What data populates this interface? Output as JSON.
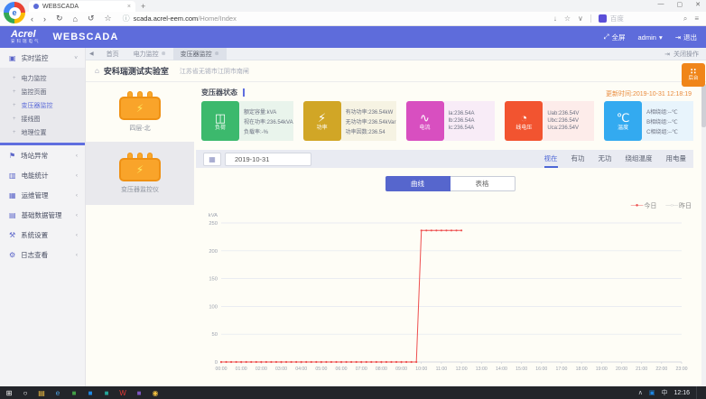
{
  "browser": {
    "tab_title": "WEBSCADA",
    "logo_glyph": "e",
    "url_host": "scada.acrel-eem.com",
    "url_path": "/Home/Index",
    "search_engine": "百度",
    "icons": {
      "back": "‹",
      "forward": "›",
      "refresh": "↻",
      "home": "⌂",
      "history": "↺",
      "star": "☆",
      "site_info": "ⓘ",
      "download": "↓",
      "fav": "☆",
      "caret": "∨",
      "search": "⌕",
      "menu": "≡",
      "minimize": "—",
      "maximize": "▢",
      "close": "✕",
      "tab_close": "×",
      "new_tab": "+"
    }
  },
  "app_header": {
    "brand_en": "Acrel",
    "brand_cn": "安科瑞电气",
    "product": "WEBSCADA",
    "fullscreen_icon": "⤢",
    "fullscreen_label": "全屏",
    "user": "admin",
    "user_caret": "▾",
    "logout_icon": "⇥",
    "logout_label": "退出"
  },
  "tab_bar": {
    "collapse_icon": "◀",
    "tabs": [
      {
        "label": "首页"
      },
      {
        "label": "电力监控",
        "close_icon": "⊗"
      },
      {
        "label": "变压器监控",
        "close_icon": "⊗"
      }
    ],
    "close_ops_icon": "⇥",
    "close_ops_label": "关闭操作"
  },
  "sidebar": {
    "groups": [
      {
        "icon": "▣",
        "label": "实时监控",
        "chevron": "˅",
        "children": [
          "电力监控",
          "监控页面",
          "变压器监控",
          "接线图",
          "地理位置"
        ],
        "child_bullet": "+"
      },
      {
        "icon": "⚑",
        "label": "场站异常",
        "chevron": "‹"
      },
      {
        "icon": "▥",
        "label": "电能统计",
        "chevron": "‹"
      },
      {
        "icon": "▦",
        "label": "运维管理",
        "chevron": "‹"
      },
      {
        "icon": "▤",
        "label": "基础数据管理",
        "chevron": "‹"
      },
      {
        "icon": "⚒",
        "label": "系统设置",
        "chevron": "‹"
      },
      {
        "icon": "⚙",
        "label": "日志查看",
        "chevron": "‹"
      }
    ]
  },
  "station": {
    "home_icon": "⌂",
    "name": "安科瑞测试实验室",
    "address": "江苏省无锡市江阴市南闸"
  },
  "devices": [
    {
      "label": "四层-北",
      "bolt": "⚡"
    },
    {
      "label": "变压器监控仪",
      "bolt": "⚡"
    }
  ],
  "status": {
    "title": "变压器状态",
    "updated": "更新时间:2019-10-31 12:18:19",
    "cards": [
      {
        "label": "负荷",
        "glyph": "◫",
        "color": "#3cb96d",
        "bg": "#e9f4ec",
        "lines": [
          "额定容量:kVA",
          "视在功率:236.54kVA",
          "负载率:-%"
        ]
      },
      {
        "label": "功率",
        "glyph": "⚡",
        "color": "#d1a626",
        "bg": "#f6f3e3",
        "lines": [
          "有功功率:236.54kW",
          "无功功率:236.54kVar",
          "功率因数:236.54"
        ]
      },
      {
        "label": "电流",
        "glyph": "∿",
        "color": "#d84fc0",
        "bg": "#f8ecf7",
        "lines": [
          "Ia:236.54A",
          "Ib:236.54A",
          "Ic:236.54A"
        ]
      },
      {
        "label": "线电压",
        "glyph": "◔",
        "color": "#f25430",
        "bg": "#fdecea",
        "lines": [
          "Uab:236.54V",
          "Ubc:236.54V",
          "Uca:236.54V"
        ]
      },
      {
        "label": "温度",
        "glyph": "℃",
        "color": "#33aaf0",
        "bg": "#e8f4fc",
        "lines": [
          "A相绕组:--℃",
          "B相绕组:--℃",
          "C相绕组:--℃"
        ]
      }
    ]
  },
  "controls": {
    "calendar_icon": "▦",
    "date": "2019-10-31",
    "metrics": [
      "视在",
      "有功",
      "无功",
      "绕组温度",
      "用电量"
    ],
    "active_metric": "视在",
    "views": [
      "曲线",
      "表格"
    ],
    "active_view": "曲线"
  },
  "float_button": {
    "icon": "∷",
    "label": "后台"
  },
  "chart_data": {
    "type": "line",
    "ylabel": "kVA",
    "ylim": [
      0,
      250
    ],
    "yticks": [
      0,
      50,
      100,
      150,
      200,
      250
    ],
    "grid": true,
    "legend_position": "top-right",
    "x_labels": [
      "00:00",
      "01:00",
      "02:00",
      "03:00",
      "04:00",
      "05:00",
      "06:00",
      "07:00",
      "08:00",
      "09:00",
      "10:00",
      "11:00",
      "12:00",
      "13:00",
      "14:00",
      "15:00",
      "16:00",
      "17:00",
      "18:00",
      "19:00",
      "20:00",
      "21:00",
      "22:00",
      "23:00"
    ],
    "series": [
      {
        "name": "今日",
        "color": "#ee4f4f",
        "swatch": "—●—",
        "start": "00:00",
        "interval_minutes": 15,
        "values": [
          0,
          0,
          0,
          0,
          0,
          0,
          0,
          0,
          0,
          0,
          0,
          0,
          0,
          0,
          0,
          0,
          0,
          0,
          0,
          0,
          0,
          0,
          0,
          0,
          0,
          0,
          0,
          0,
          0,
          0,
          0,
          0,
          0,
          0,
          0,
          0,
          0,
          0,
          0,
          0,
          236.54,
          236.54,
          236.54,
          236.54,
          236.54,
          236.54,
          236.54,
          236.54,
          236.54
        ]
      },
      {
        "name": "昨日",
        "color": "#c8c8c8",
        "swatch": "—○—",
        "start": "00:00",
        "interval_minutes": 15,
        "values": []
      }
    ]
  },
  "taskbar": {
    "icons": [
      {
        "name": "start",
        "glyph": "⊞",
        "color": "#ffffff"
      },
      {
        "name": "search",
        "glyph": "○",
        "color": "#ffffff"
      },
      {
        "name": "file-explorer",
        "glyph": "▤",
        "color": "#f6c244"
      },
      {
        "name": "browser-e",
        "glyph": "e",
        "color": "#4fa3e3"
      },
      {
        "name": "app-green",
        "glyph": "■",
        "color": "#43a047"
      },
      {
        "name": "app-blue",
        "glyph": "■",
        "color": "#1e88e5"
      },
      {
        "name": "app-teal",
        "glyph": "■",
        "color": "#26a69a"
      },
      {
        "name": "wps",
        "glyph": "W",
        "color": "#e53935"
      },
      {
        "name": "app-purple",
        "glyph": "■",
        "color": "#7e57c2"
      },
      {
        "name": "chrome",
        "glyph": "◉",
        "color": "#f1c040"
      }
    ],
    "tray": {
      "chevron": "∧",
      "app": "▣",
      "ime": "中",
      "time": "12:16"
    }
  }
}
